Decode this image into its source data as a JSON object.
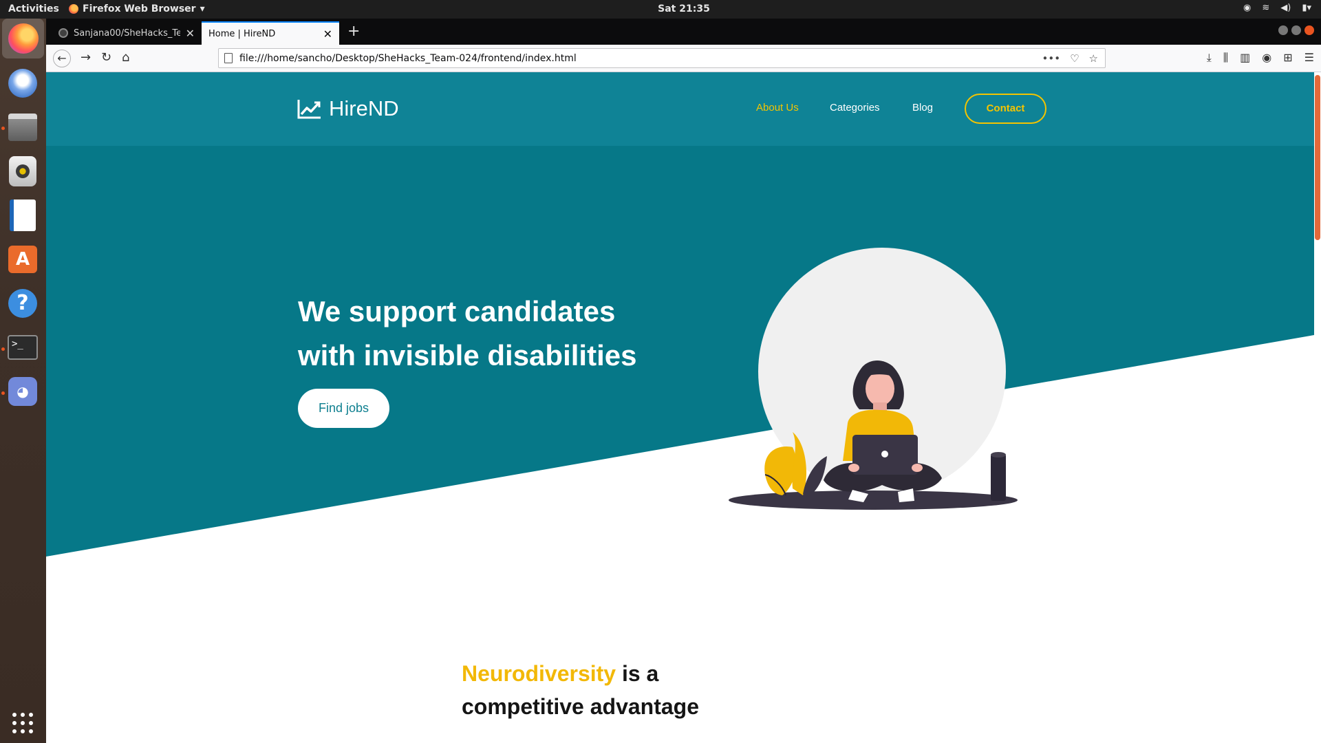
{
  "os": {
    "activities": "Activities",
    "app_name": "Firefox Web Browser",
    "clock": "Sat 21:35"
  },
  "browser": {
    "tabs": [
      {
        "title": "Sanjana00/SheHacks_Te",
        "active": false
      },
      {
        "title": "Home | HireND",
        "active": true
      }
    ],
    "url": "file:///home/sancho/Desktop/SheHacks_Team-024/frontend/index.html"
  },
  "site": {
    "logo_text": "HireND",
    "nav": {
      "about": "About Us",
      "categories": "Categories",
      "blog": "Blog",
      "contact": "Contact"
    },
    "hero": {
      "line1": "We support candidates",
      "line2": "with invisible disabilities",
      "cta": "Find jobs"
    },
    "section": {
      "accent": "Neurodiversity",
      "rest1": " is a",
      "rest2": "competitive advantage"
    }
  },
  "colors": {
    "primary_teal": "#0d7f8f",
    "accent_yellow": "#f5c400",
    "dark_text": "#151515"
  }
}
